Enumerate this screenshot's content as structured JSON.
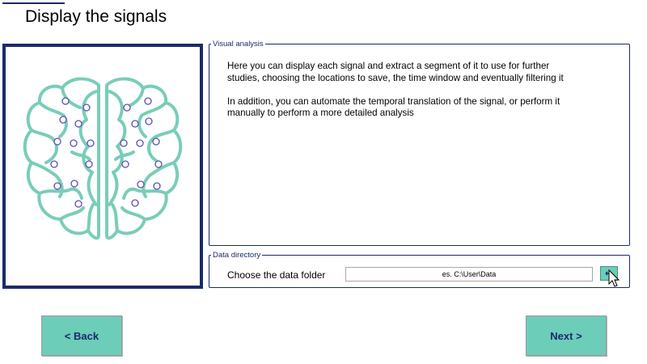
{
  "page": {
    "title": "Display the signals"
  },
  "visual_analysis": {
    "legend": "Visual analysis",
    "paragraph1": "Here you can display each signal and extract a segment of it to use for further studies, choosing the locations to save, the time window and eventually filtering it",
    "paragraph2": "In addition, you can automate the temporal translation of the signal, or perform it manually to perform a more detailed analysis"
  },
  "data_directory": {
    "legend": "Data directory",
    "label": "Choose the data folder",
    "input_value": "es. C:\\User\\Data",
    "browse_icon": "arrow-left-icon"
  },
  "nav": {
    "back_label": "<  Back",
    "next_label": "Next  >"
  },
  "colors": {
    "accent": "#6ccdb8",
    "navy": "#1b2a6b",
    "brain": "#79cdb9",
    "electrode": "#5a4fb0"
  },
  "illustration": {
    "icon": "brain-electrodes-icon"
  }
}
